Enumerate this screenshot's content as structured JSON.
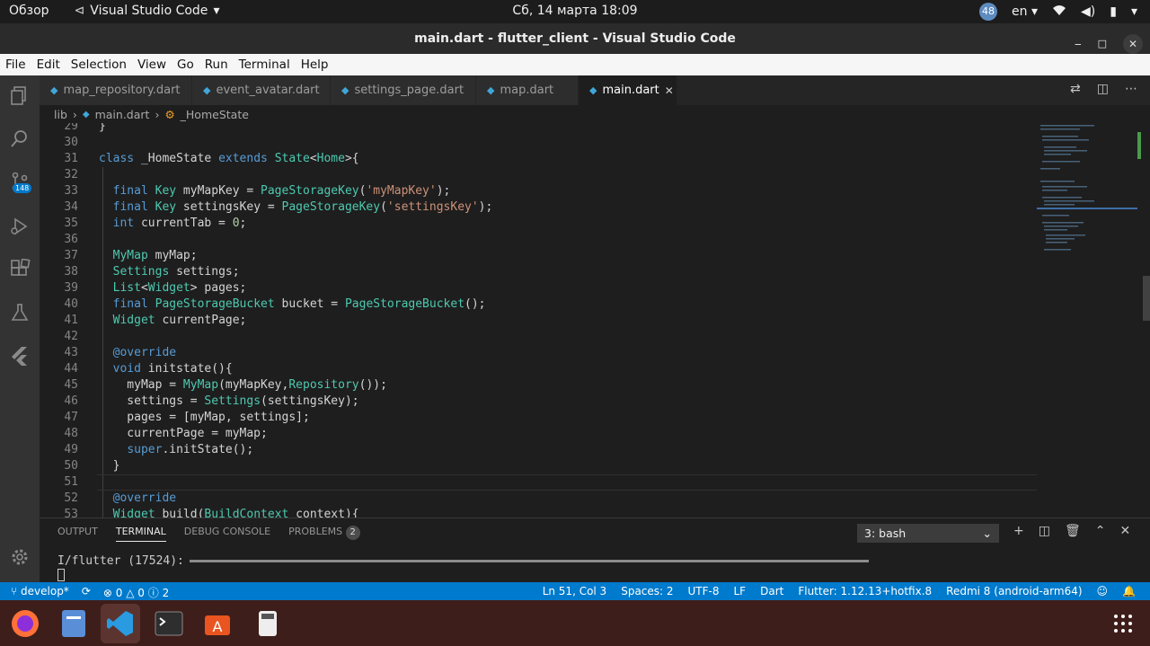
{
  "topbar": {
    "overview": "Обзор",
    "app_name": "Visual Studio Code",
    "clock": "Сб, 14 марта  18:09",
    "notif_count": "48",
    "language": "en"
  },
  "window": {
    "title": "main.dart - flutter_client - Visual Studio Code"
  },
  "menu": [
    "File",
    "Edit",
    "Selection",
    "View",
    "Go",
    "Run",
    "Terminal",
    "Help"
  ],
  "activity": {
    "scm_badge": "148"
  },
  "tabs": [
    {
      "label": "map_repository.dart"
    },
    {
      "label": "event_avatar.dart"
    },
    {
      "label": "settings_page.dart"
    },
    {
      "label": "map.dart"
    },
    {
      "label": "main.dart"
    }
  ],
  "breadcrumb": {
    "folder": "lib",
    "file": "main.dart",
    "symbol": "_HomeState"
  },
  "code": [
    {
      "n": "29",
      "t": "}"
    },
    {
      "n": "30",
      "t": ""
    },
    {
      "n": "31",
      "t": "class _HomeState extends State<Home>{"
    },
    {
      "n": "32",
      "t": ""
    },
    {
      "n": "33",
      "t": "  final Key myMapKey = PageStorageKey('myMapKey');"
    },
    {
      "n": "34",
      "t": "  final Key settingsKey = PageStorageKey('settingsKey');"
    },
    {
      "n": "35",
      "t": "  int currentTab = 0;"
    },
    {
      "n": "36",
      "t": ""
    },
    {
      "n": "37",
      "t": "  MyMap myMap;"
    },
    {
      "n": "38",
      "t": "  Settings settings;"
    },
    {
      "n": "39",
      "t": "  List<Widget> pages;"
    },
    {
      "n": "40",
      "t": "  final PageStorageBucket bucket = PageStorageBucket();"
    },
    {
      "n": "41",
      "t": "  Widget currentPage;"
    },
    {
      "n": "42",
      "t": ""
    },
    {
      "n": "43",
      "t": "  @override"
    },
    {
      "n": "44",
      "t": "  void initstate(){"
    },
    {
      "n": "45",
      "t": "    myMap = MyMap(myMapKey,Repository());"
    },
    {
      "n": "46",
      "t": "    settings = Settings(settingsKey);"
    },
    {
      "n": "47",
      "t": "    pages = [myMap, settings];"
    },
    {
      "n": "48",
      "t": "    currentPage = myMap;"
    },
    {
      "n": "49",
      "t": "    super.initState();"
    },
    {
      "n": "50",
      "t": "  }"
    },
    {
      "n": "51",
      "t": ""
    },
    {
      "n": "52",
      "t": "  @override"
    },
    {
      "n": "53",
      "t": "  Widget build(BuildContext context){"
    }
  ],
  "panel": {
    "tabs": [
      "OUTPUT",
      "TERMINAL",
      "DEBUG CONSOLE",
      "PROBLEMS"
    ],
    "problems_count": "2",
    "terminal_select": "3: bash",
    "terminal_text": "I/flutter (17524):"
  },
  "status": {
    "branch": "develop*",
    "errors": "0",
    "warnings": "0",
    "infos": "2",
    "position": "Ln 51, Col 3",
    "spaces": "Spaces: 2",
    "encoding": "UTF-8",
    "eol": "LF",
    "language": "Dart",
    "flutter": "Flutter: 1.12.13+hotfix.8",
    "device": "Redmi 8 (android-arm64)"
  },
  "colors": {
    "accent": "#007acc",
    "editor_bg": "#1e1e1e",
    "keyword": "#569cd6",
    "type": "#4ec9b0",
    "string": "#ce9178"
  }
}
